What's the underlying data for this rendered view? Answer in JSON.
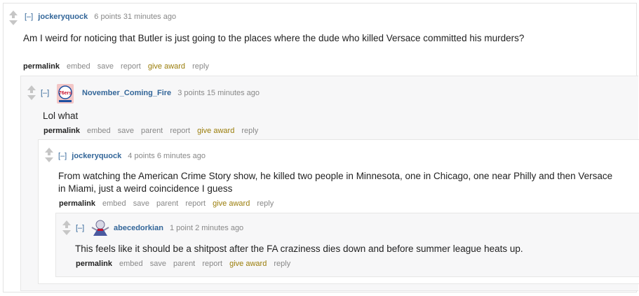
{
  "comments": [
    {
      "expand": "[–]",
      "author": "jockeryquock",
      "points": "6 points",
      "time": "31 minutes ago",
      "body": "Am I weird for noticing that Butler is just going to the places where the dude who killed Versace committed his murders?",
      "actions": [
        "permalink",
        "embed",
        "save",
        "report",
        "give award",
        "reply"
      ]
    },
    {
      "expand": "[–]",
      "author": "November_Coming_Fire",
      "avatar_text": "76ers",
      "points": "3 points",
      "time": "15 minutes ago",
      "body": "Lol what",
      "actions": [
        "permalink",
        "embed",
        "save",
        "parent",
        "report",
        "give award",
        "reply"
      ]
    },
    {
      "expand": "[–]",
      "author": "jockeryquock",
      "points": "4 points",
      "time": "6 minutes ago",
      "body": "From watching the American Crime Story show, he killed two people in Minnesota, one in Chicago, one near Philly and then Versace in Miami, just a weird coincidence I guess",
      "actions": [
        "permalink",
        "embed",
        "save",
        "parent",
        "report",
        "give award",
        "reply"
      ]
    },
    {
      "expand": "[–]",
      "author": "abecedorkian",
      "points": "1 point",
      "time": "2 minutes ago",
      "body": "This feels like it should be a shitpost after the FA craziness dies down and before summer league heats up.",
      "actions": [
        "permalink",
        "embed",
        "save",
        "parent",
        "report",
        "give award",
        "reply"
      ]
    }
  ],
  "colors": {
    "author": "#336699",
    "award": "#9a7d0a",
    "meta": "#888888",
    "nested_bg": "#f7f7f8"
  }
}
